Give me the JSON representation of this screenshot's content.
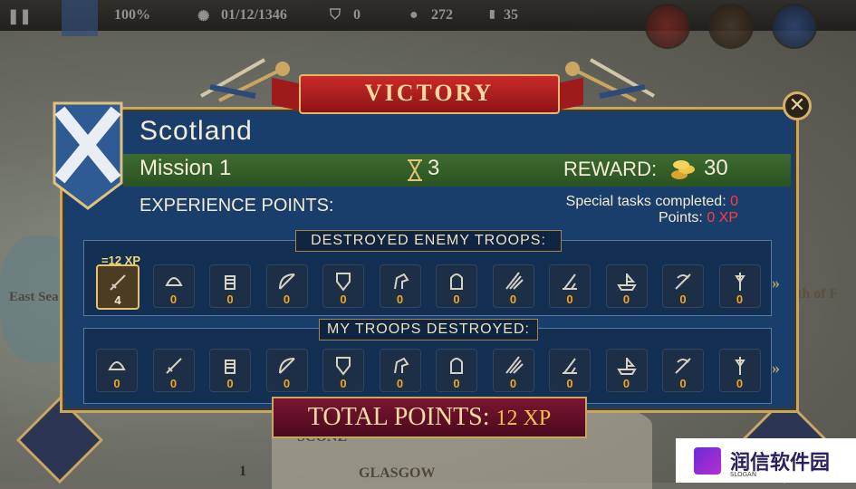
{
  "topbar": {
    "percent": "100%",
    "date": "01/12/1346",
    "shields": "0",
    "coins": "272",
    "barrels": "35"
  },
  "map": {
    "label_east_sea": "East Sea of the Hebrides",
    "label_scone": "SCONE",
    "label_glasgow": "GLASGOW",
    "label_firth": "th of F",
    "barrel_count": "1"
  },
  "dialog": {
    "banner": "VICTORY",
    "country": "Scotland",
    "mission": "Mission 1",
    "turns": "3",
    "reward_label": "REWARD:",
    "reward_value": "30",
    "experience_label": "EXPERIENCE POINTS:",
    "special_tasks_label": "Special tasks completed:",
    "special_tasks_value": "0",
    "points_label": "Points:",
    "points_value": "0 XP",
    "destroyed_title": "DESTROYED ENEMY TROOPS:",
    "lost_title": "MY TROOPS DESTROYED:",
    "xp_tag": "=12 XP",
    "total_label": "TOTAL POINTS:",
    "total_value": "12 XP",
    "close_icon": "close-icon"
  },
  "destroyed_units": [
    {
      "icon": "sword-icon",
      "count": "4"
    },
    {
      "icon": "helmet-icon",
      "count": "0"
    },
    {
      "icon": "gauntlet-icon",
      "count": "0"
    },
    {
      "icon": "bow-icon",
      "count": "0"
    },
    {
      "icon": "shield-icon",
      "count": "0"
    },
    {
      "icon": "horse-icon",
      "count": "0"
    },
    {
      "icon": "armored-horse-icon",
      "count": "0"
    },
    {
      "icon": "pike-icon",
      "count": "0"
    },
    {
      "icon": "catapult-icon",
      "count": "0"
    },
    {
      "icon": "ship-icon",
      "count": "0"
    },
    {
      "icon": "crossbow-icon",
      "count": "0"
    },
    {
      "icon": "halberd-icon",
      "count": "0"
    }
  ],
  "lost_units": [
    {
      "icon": "helmet-icon",
      "count": "0"
    },
    {
      "icon": "sword-icon",
      "count": "0"
    },
    {
      "icon": "gauntlet-icon",
      "count": "0"
    },
    {
      "icon": "bow-icon",
      "count": "0"
    },
    {
      "icon": "shield-icon",
      "count": "0"
    },
    {
      "icon": "horse-icon",
      "count": "0"
    },
    {
      "icon": "armored-horse-icon",
      "count": "0"
    },
    {
      "icon": "pike-icon",
      "count": "0"
    },
    {
      "icon": "catapult-icon",
      "count": "0"
    },
    {
      "icon": "ship-icon",
      "count": "0"
    },
    {
      "icon": "crossbow-icon",
      "count": "0"
    },
    {
      "icon": "halberd-icon",
      "count": "0"
    }
  ],
  "watermark": {
    "text": "润信软件园",
    "slogan": "SLOGAN"
  },
  "colors": {
    "panel": "#1a3e6b",
    "gold": "#c9a760",
    "mission_bar": "#3d6a31",
    "banner_red": "#c92a2a",
    "count_orange": "#f2a51f"
  }
}
